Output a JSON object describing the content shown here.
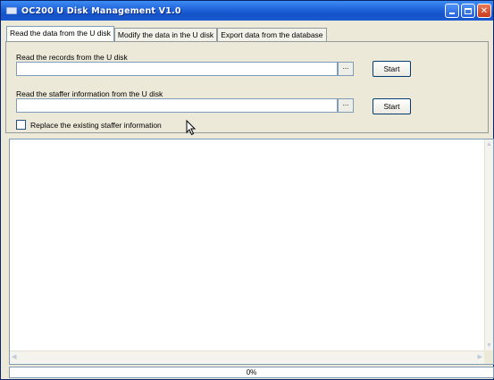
{
  "window": {
    "title": "OC200 U Disk Management V1.0",
    "min_glyph": "minimize-icon",
    "max_glyph": "maximize-icon",
    "close_glyph": "✕"
  },
  "tabs": [
    {
      "label": "Read the data from the U disk",
      "active": true
    },
    {
      "label": "Modify the data in the U disk",
      "active": false
    },
    {
      "label": "Export data from the database",
      "active": false
    }
  ],
  "records": {
    "label": "Read the records from the U disk",
    "path_value": "",
    "browse_label": "...",
    "start_label": "Start"
  },
  "staffer": {
    "label": "Read the staffer information from the U disk",
    "path_value": "",
    "browse_label": "...",
    "start_label": "Start"
  },
  "replace_option": {
    "label": "Replace the existing staffer information",
    "checked": false
  },
  "log": {
    "content": ""
  },
  "status": {
    "progress_text": "0%",
    "progress": 0
  },
  "colors": {
    "titlebar": "#1f62d8",
    "window_bg": "#ece9d8",
    "close_button": "#c8391d"
  }
}
